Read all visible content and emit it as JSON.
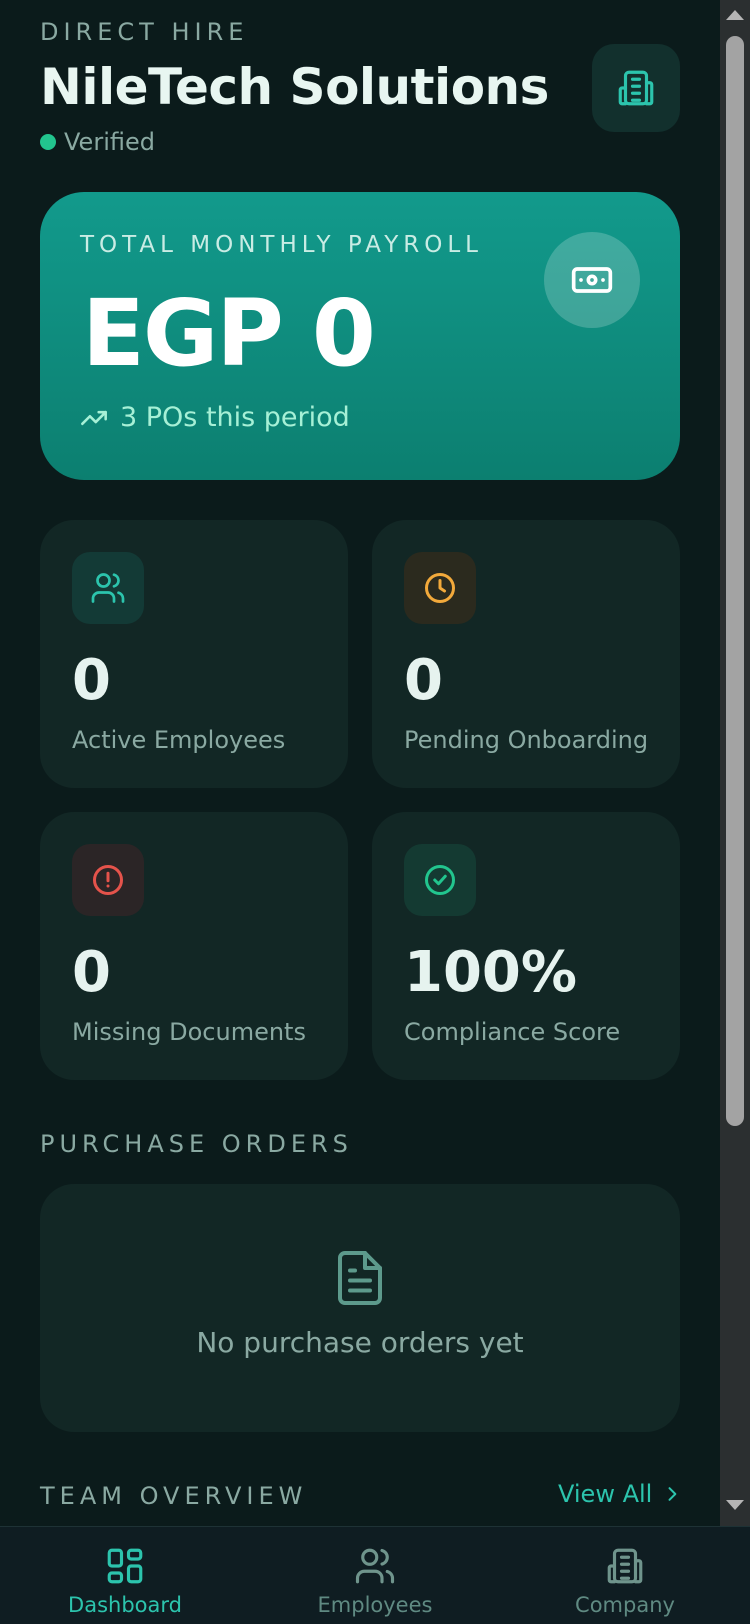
{
  "header": {
    "eyebrow": "DIRECT HIRE",
    "company_name": "NileTech Solutions",
    "status": "Verified",
    "company_icon": "building-icon"
  },
  "payroll": {
    "label": "TOTAL MONTHLY PAYROLL",
    "amount": "EGP 0",
    "trend_text": "3 POs this period",
    "icon": "banknote-icon"
  },
  "stats": [
    {
      "value": "0",
      "label": "Active Employees",
      "icon": "users-icon",
      "color": "#2cc4ad"
    },
    {
      "value": "0",
      "label": "Pending Onboarding",
      "icon": "clock-icon",
      "color": "#f2a93b"
    },
    {
      "value": "0",
      "label": "Missing Documents",
      "icon": "alert-circle-icon",
      "color": "#e5534b"
    },
    {
      "value": "100%",
      "label": "Compliance Score",
      "icon": "check-circle-icon",
      "color": "#22c58e"
    }
  ],
  "purchase_orders": {
    "title": "PURCHASE ORDERS",
    "empty_text": "No purchase orders yet",
    "empty_icon": "document-icon"
  },
  "team_overview": {
    "title": "TEAM OVERVIEW",
    "view_all": "View All"
  },
  "bottom_nav": {
    "items": [
      {
        "label": "Dashboard",
        "icon": "dashboard-grid-icon",
        "active": true
      },
      {
        "label": "Employees",
        "icon": "users-icon",
        "active": false
      },
      {
        "label": "Company",
        "icon": "building-icon",
        "active": false
      }
    ]
  },
  "colors": {
    "background": "#0b1b1b",
    "card": "#122725",
    "accent": "#2cc4ad",
    "payroll_gradient_top": "#129a8c",
    "payroll_gradient_bottom": "#0c7f70",
    "muted_text": "#8aa9a2"
  }
}
